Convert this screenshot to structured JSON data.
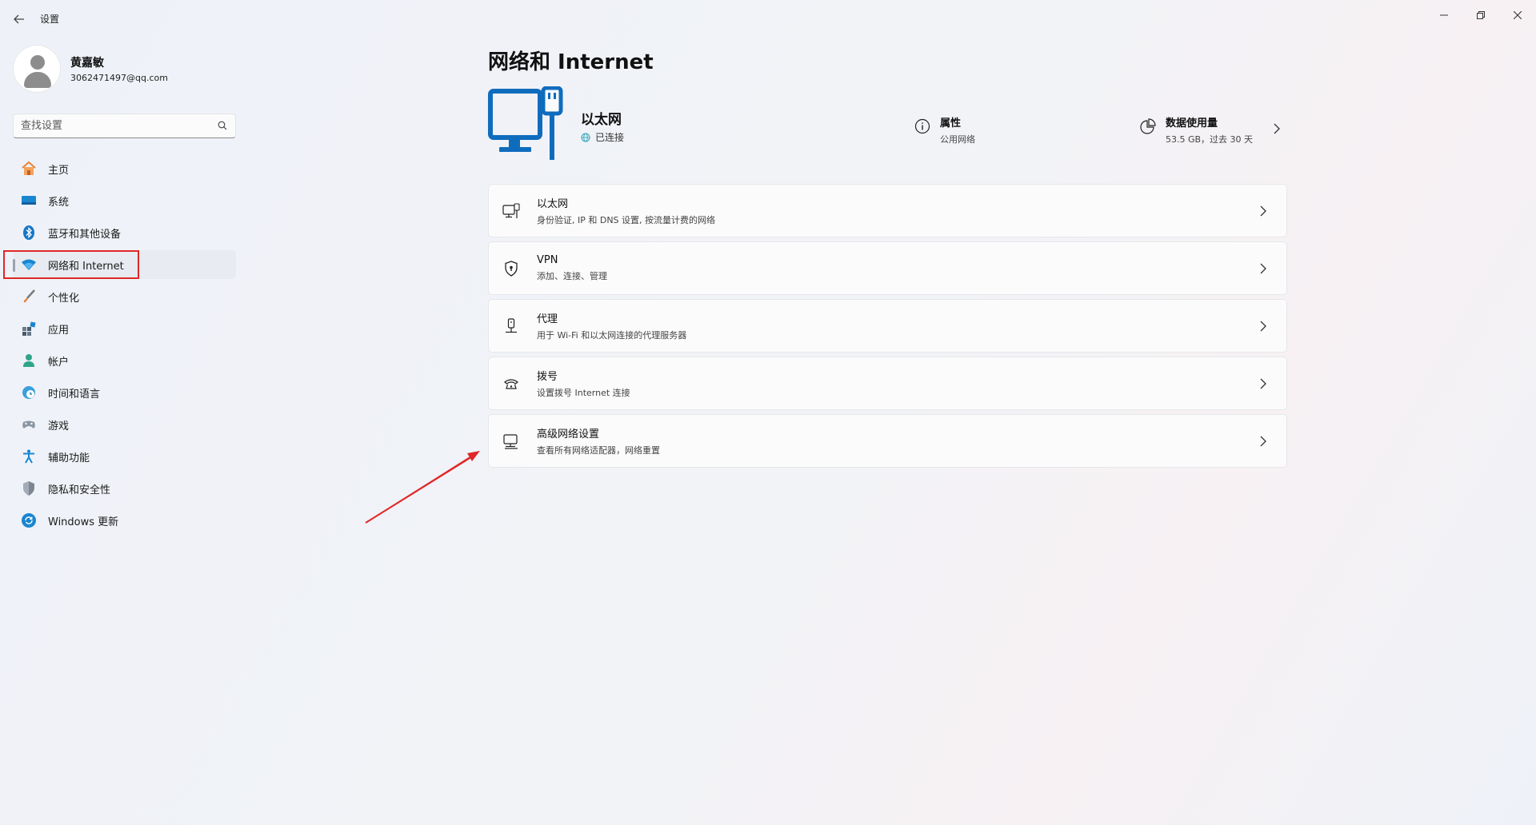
{
  "window": {
    "title": "设置",
    "controls": {
      "minimize": "minimize-icon",
      "maximize": "restore-icon",
      "close": "close-icon"
    }
  },
  "profile": {
    "name": "黄嘉敏",
    "email": "3062471497@qq.com"
  },
  "search": {
    "placeholder": "查找设置",
    "value": ""
  },
  "sidebar": {
    "items": [
      {
        "label": "主页",
        "icon": "home-icon"
      },
      {
        "label": "系统",
        "icon": "system-icon"
      },
      {
        "label": "蓝牙和其他设备",
        "icon": "bluetooth-icon"
      },
      {
        "label": "网络和 Internet",
        "icon": "wifi-icon",
        "active": true
      },
      {
        "label": "个性化",
        "icon": "brush-icon"
      },
      {
        "label": "应用",
        "icon": "apps-icon"
      },
      {
        "label": "帐户",
        "icon": "account-icon"
      },
      {
        "label": "时间和语言",
        "icon": "time-language-icon"
      },
      {
        "label": "游戏",
        "icon": "gamepad-icon"
      },
      {
        "label": "辅助功能",
        "icon": "accessibility-icon"
      },
      {
        "label": "隐私和安全性",
        "icon": "shield-icon"
      },
      {
        "label": "Windows 更新",
        "icon": "update-icon"
      }
    ]
  },
  "main": {
    "title": "网络和 Internet",
    "hero": {
      "name": "以太网",
      "status": "已连接",
      "properties": {
        "title": "属性",
        "sub": "公用网络"
      },
      "usage": {
        "title": "数据使用量",
        "sub": "53.5 GB，过去 30 天"
      }
    },
    "cards": [
      {
        "title": "以太网",
        "sub": "身份验证, IP 和 DNS 设置, 按流量计费的网络",
        "icon": "ethernet-icon"
      },
      {
        "title": "VPN",
        "sub": "添加、连接、管理",
        "icon": "vpn-shield-icon"
      },
      {
        "title": "代理",
        "sub": "用于 Wi-Fi 和以太网连接的代理服务器",
        "icon": "proxy-icon"
      },
      {
        "title": "拨号",
        "sub": "设置拨号 Internet 连接",
        "icon": "dialup-icon"
      },
      {
        "title": "高级网络设置",
        "sub": "查看所有网络适配器，网络重置",
        "icon": "advanced-network-icon"
      }
    ]
  },
  "colors": {
    "accent": "#0f6cbd",
    "annotation": "#e02727"
  }
}
